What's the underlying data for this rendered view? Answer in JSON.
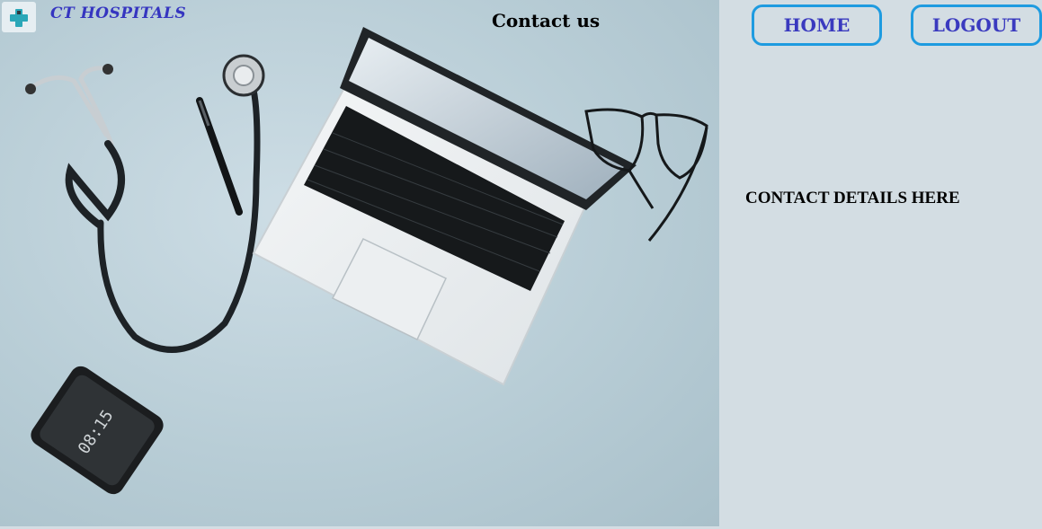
{
  "brand": {
    "name": "CT HOSPITALS",
    "logo_icon": "medical-cross-icon"
  },
  "header": {
    "title": "Contact us"
  },
  "nav": {
    "home_label": "HOME",
    "logout_label": "LOGOUT"
  },
  "content": {
    "contact_details": "CONTACT DETAILS HERE"
  },
  "hero_image": {
    "phone_time": "08:15"
  },
  "colors": {
    "brand_text": "#3535c0",
    "nav_text": "#3a3abf",
    "nav_border": "#1e9be0",
    "panel_bg": "#d3dde3"
  }
}
